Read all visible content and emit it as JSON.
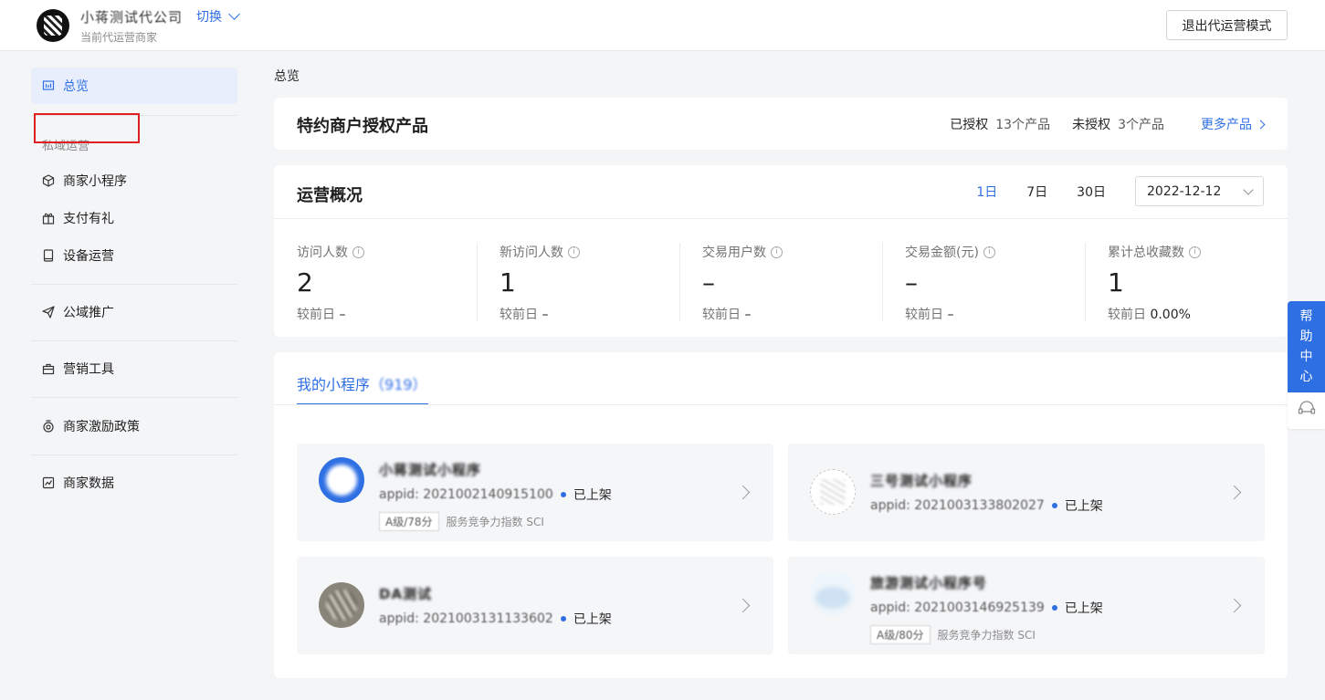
{
  "header": {
    "merchant_name": "小蒋测试代公司",
    "switch_label": "切换",
    "merchant_subtitle": "当前代运营商家",
    "exit_button": "退出代运营模式"
  },
  "sidebar": {
    "overview": "总览",
    "group_private": "私域运营",
    "mini_program": "商家小程序",
    "pay_gift": "支付有礼",
    "device_ops": "设备运营",
    "public_promo": "公域推广",
    "marketing_tools": "营销工具",
    "incentive_policy": "商家激励政策",
    "merchant_data": "商家数据"
  },
  "breadcrumb": "总览",
  "auth_card": {
    "title": "特约商户授权产品",
    "authorized_label": "已授权",
    "authorized_count": "13个产品",
    "unauthorized_label": "未授权",
    "unauthorized_count": "3个产品",
    "more_link": "更多产品"
  },
  "ops_card": {
    "title": "运营概况",
    "periods": [
      "1日",
      "7日",
      "30日"
    ],
    "active_period": "1日",
    "date": "2022-12-12",
    "metrics": [
      {
        "label": "访问人数",
        "value": "2",
        "compare_label": "较前日",
        "compare_value": "–"
      },
      {
        "label": "新访问人数",
        "value": "1",
        "compare_label": "较前日",
        "compare_value": "–"
      },
      {
        "label": "交易用户数",
        "value": "–",
        "compare_label": "较前日",
        "compare_value": "–"
      },
      {
        "label": "交易金额(元)",
        "value": "–",
        "compare_label": "较前日",
        "compare_value": "–"
      },
      {
        "label": "累计总收藏数",
        "value": "1",
        "compare_label": "较前日",
        "compare_value": "0.00%"
      }
    ]
  },
  "mini_programs": {
    "tab_label": "我的小程序",
    "tab_count": "（919）",
    "items": [
      {
        "name": "小蒋测试小程序",
        "appid": "appid: 2021002140915100",
        "status": "已上架",
        "sci_tag": "A级/78分",
        "sci_label": "服务竞争力指数 SCI"
      },
      {
        "name": "三号测试小程序",
        "appid": "appid: 2021003133802027",
        "status": "已上架"
      },
      {
        "name": "DA测试",
        "appid": "appid: 2021003131133602",
        "status": "已上架"
      },
      {
        "name": "旅游测试小程序号",
        "appid": "appid: 2021003146925139",
        "status": "已上架",
        "sci_tag": "A级/80分",
        "sci_label": "服务竞争力指数 SCI"
      }
    ]
  },
  "help": {
    "chars": [
      "帮",
      "助",
      "中",
      "心"
    ]
  }
}
